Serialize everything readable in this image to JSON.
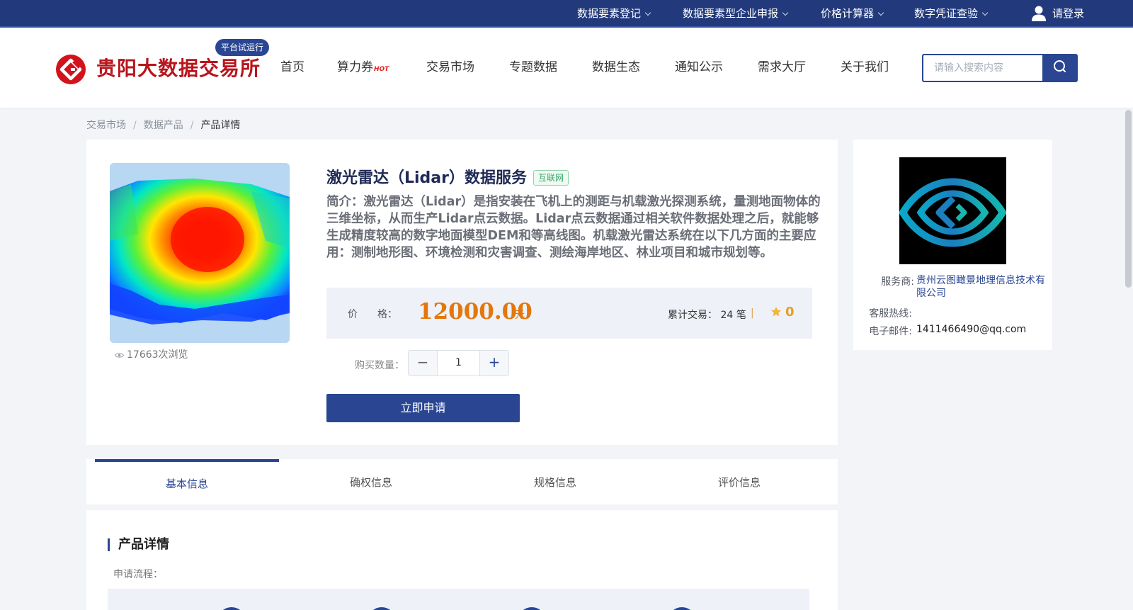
{
  "topbar": {
    "items": [
      "数据要素登记",
      "数据要素型企业申报",
      "价格计算器",
      "数字凭证查验"
    ],
    "login": "请登录"
  },
  "header": {
    "site_name": "贵阳大数据交易所",
    "trial_badge": "平台试运行",
    "nav": [
      "首页",
      "算力券",
      "交易市场",
      "专题数据",
      "数据生态",
      "通知公示",
      "需求大厅",
      "关于我们"
    ],
    "hot_badge": "HOT",
    "search_placeholder": "请输入搜索内容"
  },
  "breadcrumb": [
    "交易市场",
    "数据产品",
    "产品详情"
  ],
  "product": {
    "title": "激光雷达（Lidar）数据服务",
    "tag": "互联网",
    "description": "简介：激光雷达（Lidar）是指安装在飞机上的测距与机载激光探测系统，量测地面物体的三维坐标，从而生产Lidar点云数据。Lidar点云数据通过相关软件数据处理之后，就能够生成精度较高的数字地面模型DEM和等高线图。机载激光雷达系统在以下几方面的主要应用：测制地形图、环境检测和灾害调查、测绘海岸地区、林业项目和城市规划等。",
    "views": "17663次浏览",
    "price_label": "价　　格：",
    "price": "12000.00",
    "price_unit": "元",
    "trade_count": "累计交易：  24 笔",
    "rating": "0",
    "qty_label": "购买数量：",
    "qty": "1",
    "apply_button": "立即申请"
  },
  "vendor": {
    "provider_label": "服务商:",
    "provider": "贵州云图瞰景地理信息技术有限公司",
    "hotline_label": "客服热线:",
    "email_label": "电子邮件:",
    "email": "1411466490@qq.com"
  },
  "tabs": [
    "基本信息",
    "确权信息",
    "规格信息",
    "评价信息"
  ],
  "details": {
    "section_title": "产品详情",
    "process_label": "申请流程："
  },
  "colors": {
    "primary": "#2a4693",
    "topbar": "#223a7c",
    "brand_red": "#b8151d",
    "price_orange": "#e2780c"
  }
}
